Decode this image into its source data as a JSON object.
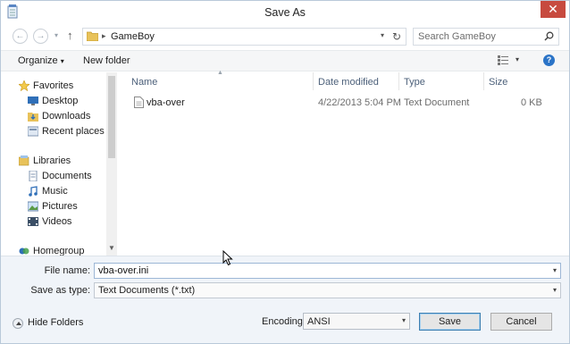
{
  "window": {
    "title": "Save As"
  },
  "address": {
    "path_label": "GameBoy"
  },
  "search": {
    "placeholder": "Search GameBoy"
  },
  "toolbar": {
    "organize_label": "Organize",
    "new_folder_label": "New folder"
  },
  "nav": {
    "favorites": {
      "label": "Favorites",
      "items": [
        {
          "label": "Desktop"
        },
        {
          "label": "Downloads"
        },
        {
          "label": "Recent places"
        }
      ]
    },
    "libraries": {
      "label": "Libraries",
      "items": [
        {
          "label": "Documents"
        },
        {
          "label": "Music"
        },
        {
          "label": "Pictures"
        },
        {
          "label": "Videos"
        }
      ]
    },
    "homegroup": {
      "label": "Homegroup"
    }
  },
  "file_list": {
    "columns": [
      "Name",
      "Date modified",
      "Type",
      "Size"
    ],
    "rows": [
      {
        "name": "vba-over",
        "date_modified": "4/22/2013 5:04 PM",
        "type": "Text Document",
        "size": "0 KB"
      }
    ]
  },
  "form": {
    "file_name_label": "File name:",
    "file_name_value": "vba-over.ini",
    "save_as_type_label": "Save as type:",
    "save_as_type_value": "Text Documents (*.txt)",
    "encoding_label": "Encoding:",
    "encoding_value": "ANSI"
  },
  "buttons": {
    "hide_folders": "Hide Folders",
    "save": "Save",
    "cancel": "Cancel"
  },
  "colors": {
    "close_button": "#c74a3f",
    "help_icon": "#2b74c7",
    "bottom_panel": "#f0f4f9"
  }
}
